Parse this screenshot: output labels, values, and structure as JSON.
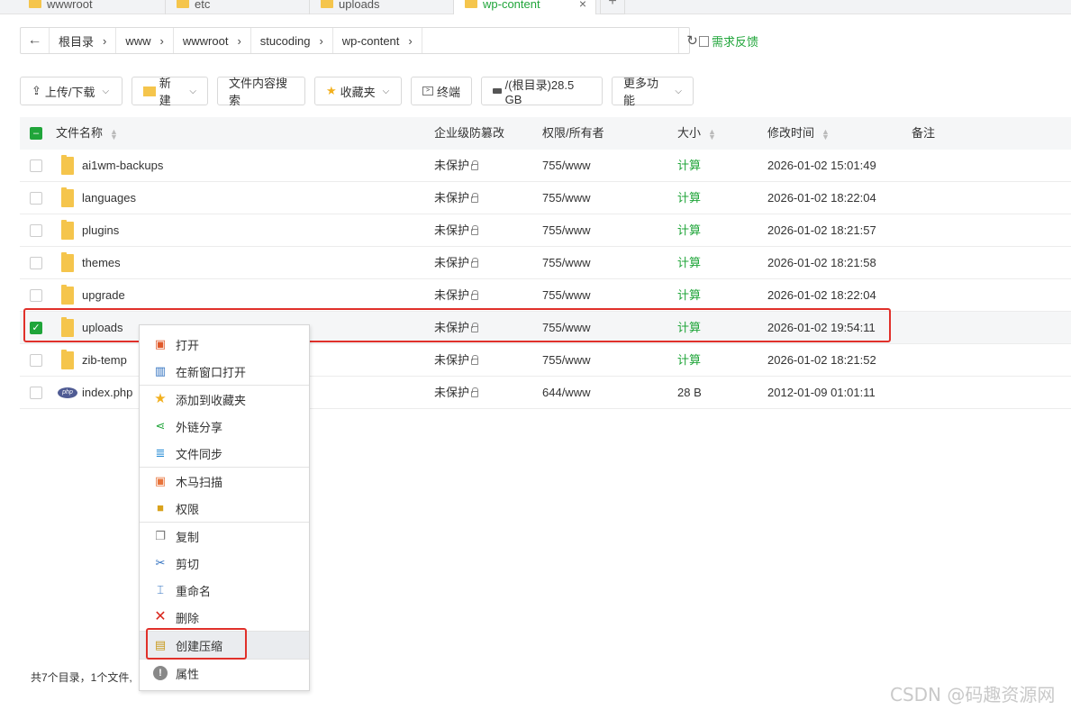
{
  "tabs": [
    {
      "label": "wwwroot"
    },
    {
      "label": "etc"
    },
    {
      "label": "uploads"
    },
    {
      "label": "wp-content",
      "close": "×"
    }
  ],
  "new_tab": "+",
  "path": {
    "back_icon": "←",
    "crumbs": [
      "根目录",
      "www",
      "wwwroot",
      "stucoding",
      "wp-content"
    ],
    "sep": "›",
    "refresh_icon": "↻",
    "feedback": "需求反馈"
  },
  "toolbar": {
    "upload": "上传/下载",
    "new": "新建",
    "search": "文件内容搜索",
    "favorites": "收藏夹",
    "terminal": "终端",
    "disk": "/(根目录)28.5 GB",
    "more": "更多功能",
    "chev": "⌵"
  },
  "table": {
    "headers": {
      "name": "文件名称",
      "tamper": "企业级防篡改",
      "perm": "权限/所有者",
      "size": "大小",
      "mtime": "修改时间",
      "note": "备注"
    },
    "rows": [
      {
        "name": "ai1wm-backups",
        "tamper": "未保护",
        "perm": "755/www",
        "size": "计算",
        "mtime": "2026-01-02 15:01:49",
        "type": "folder",
        "checked": false
      },
      {
        "name": "languages",
        "tamper": "未保护",
        "perm": "755/www",
        "size": "计算",
        "mtime": "2026-01-02 18:22:04",
        "type": "folder",
        "checked": false
      },
      {
        "name": "plugins",
        "tamper": "未保护",
        "perm": "755/www",
        "size": "计算",
        "mtime": "2026-01-02 18:21:57",
        "type": "folder",
        "checked": false
      },
      {
        "name": "themes",
        "tamper": "未保护",
        "perm": "755/www",
        "size": "计算",
        "mtime": "2026-01-02 18:21:58",
        "type": "folder",
        "checked": false
      },
      {
        "name": "upgrade",
        "tamper": "未保护",
        "perm": "755/www",
        "size": "计算",
        "mtime": "2026-01-02 18:22:04",
        "type": "folder",
        "checked": false
      },
      {
        "name": "uploads",
        "tamper": "未保护",
        "perm": "755/www",
        "size": "计算",
        "mtime": "2026-01-02 19:54:11",
        "type": "folder",
        "checked": true
      },
      {
        "name": "zib-temp",
        "tamper": "未保护",
        "perm": "755/www",
        "size": "计算",
        "mtime": "2026-01-02 18:21:52",
        "type": "folder",
        "checked": false
      },
      {
        "name": "index.php",
        "tamper": "未保护",
        "perm": "644/www",
        "size": "28 B",
        "mtime": "2012-01-09 01:01:11",
        "type": "php",
        "checked": false
      }
    ]
  },
  "context_menu": {
    "open": "打开",
    "open_new_window": "在新窗口打开",
    "add_favorite": "添加到收藏夹",
    "share": "外链分享",
    "sync": "文件同步",
    "trojan_scan": "木马扫描",
    "permission": "权限",
    "copy": "复制",
    "cut": "剪切",
    "rename": "重命名",
    "delete": "删除",
    "compress": "创建压缩",
    "properties": "属性"
  },
  "footer": "共7个目录，1个文件,",
  "watermark": "CSDN @码趣资源网",
  "colors": {
    "accent": "#20a53a",
    "highlight": "#e0302a",
    "folder": "#f5c54c"
  }
}
